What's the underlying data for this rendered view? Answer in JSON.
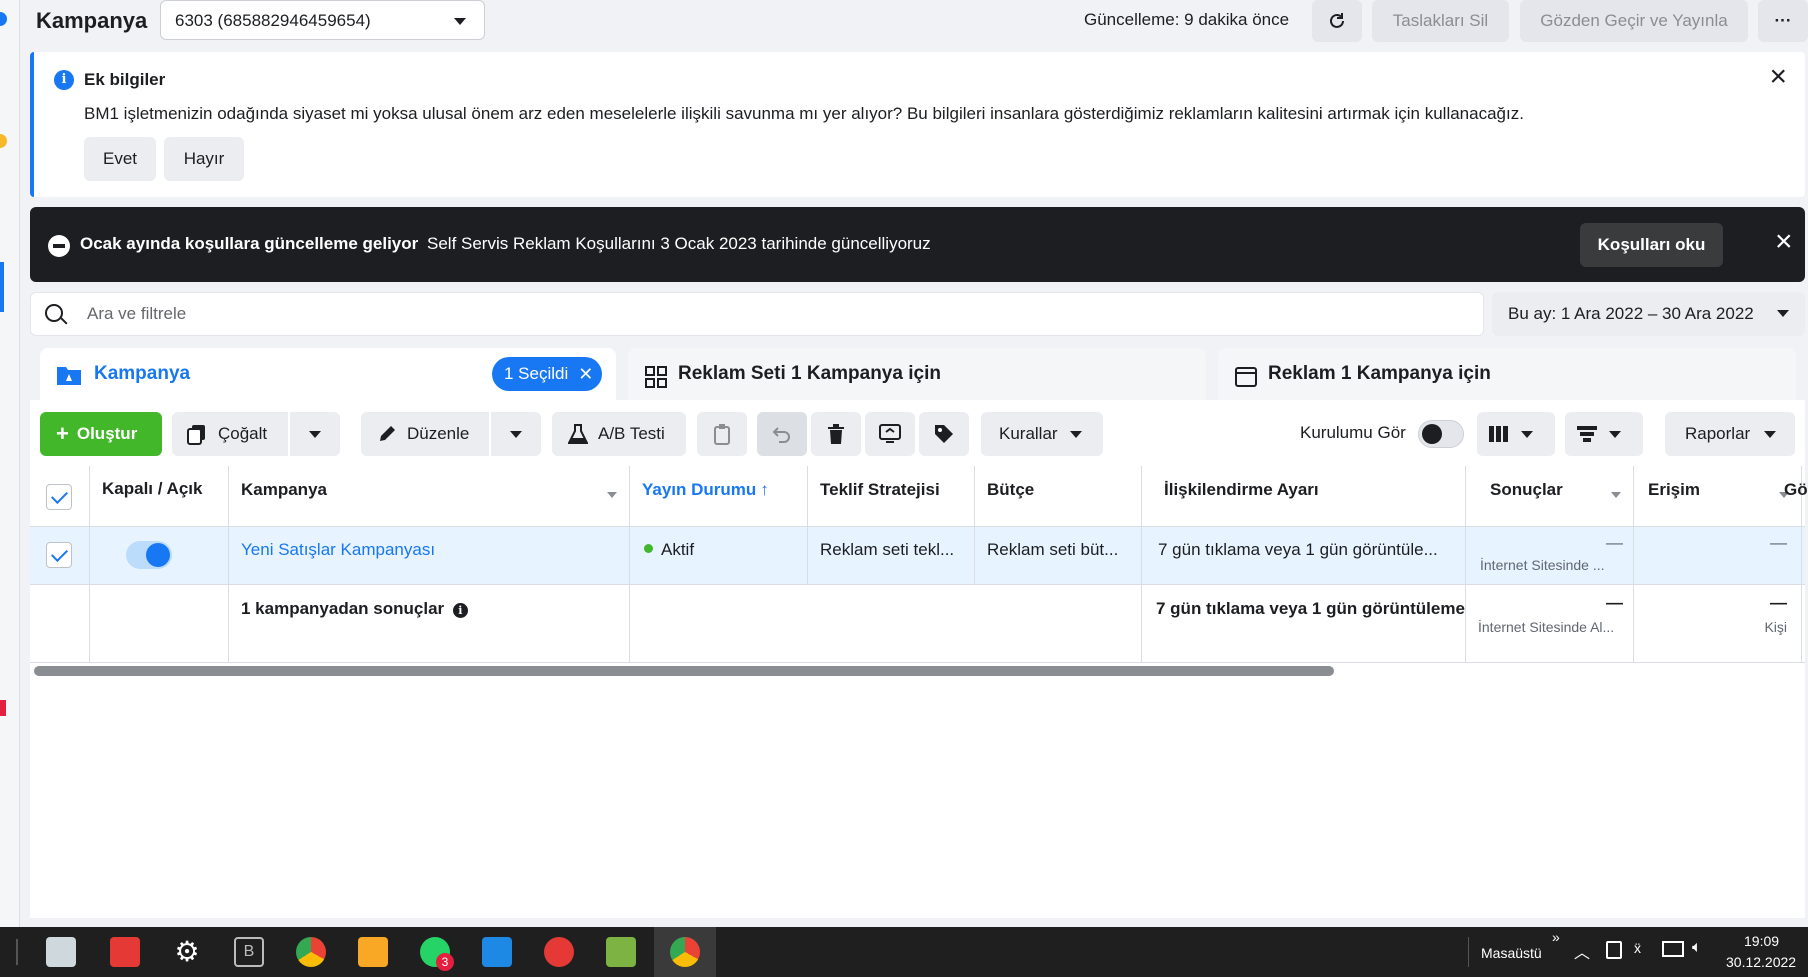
{
  "header": {
    "title": "Kampanya",
    "campaign_select": "6303 (685882946459654)",
    "update_text": "Güncelleme: 9 dakika önce",
    "delete_drafts": "Taslakları Sil",
    "review_publish": "Gözden Geçir ve Yayınla",
    "more": "···"
  },
  "info_banner": {
    "title": "Ek bilgiler",
    "body": "BM1 işletmenizin odağında siyaset mi yoksa ulusal önem arz eden meselelerle ilişkili savunma mı yer alıyor? Bu bilgileri insanlara gösterdiğimiz reklamların kalitesini artırmak için kullanacağız.",
    "yes": "Evet",
    "no": "Hayır"
  },
  "notice_banner": {
    "title": "Ocak ayında koşullara güncelleme geliyor",
    "body": "Self Servis Reklam Koşullarını 3 Ocak 2023 tarihinde güncelliyoruz",
    "button": "Koşulları oku"
  },
  "search": {
    "placeholder": "Ara ve filtrele",
    "date_range": "Bu ay: 1 Ara 2022 – 30 Ara 2022"
  },
  "tabs": [
    {
      "label": "Kampanya",
      "selected_pill": "1 Seçildi"
    },
    {
      "label": "Reklam Seti 1 Kampanya için"
    },
    {
      "label": "Reklam 1 Kampanya için"
    }
  ],
  "toolbar": {
    "create": "Oluştur",
    "duplicate": "Çoğalt",
    "edit": "Düzenle",
    "ab_test": "A/B Testi",
    "rules": "Kurallar",
    "setup_label": "Kurulumu Gör",
    "reports": "Raporlar"
  },
  "table": {
    "headers": [
      "Kapalı / Açık",
      "Kampanya",
      "Yayın Durumu",
      "Teklif Stratejisi",
      "Bütçe",
      "İlişkilendirme Ayarı",
      "Sonuçlar",
      "Erişim",
      "Gö"
    ],
    "row": {
      "name": "Yeni Satışlar Kampanyası",
      "status": "Aktif",
      "bid": "Reklam seti tekl...",
      "budget": "Reklam seti büt...",
      "attribution": "7 gün tıklama veya 1 gün görüntüle...",
      "results": "—",
      "results_sub": "İnternet Sitesinde ...",
      "reach": "—"
    },
    "summary": {
      "label": "1 kampanyadan sonuçlar",
      "attribution": "7 gün tıklama veya 1 gün görüntüleme",
      "results": "—",
      "results_sub": "İnternet Sitesinde Al...",
      "reach": "—",
      "reach_sub": "Kişi"
    }
  },
  "taskbar": {
    "desktop": "Masaüstü",
    "time": "19:09",
    "date": "30.12.2022",
    "badge": "3"
  },
  "colors": {
    "accent": "#1877f2",
    "create_green": "#42b72a",
    "active_dot": "#42b72a"
  }
}
